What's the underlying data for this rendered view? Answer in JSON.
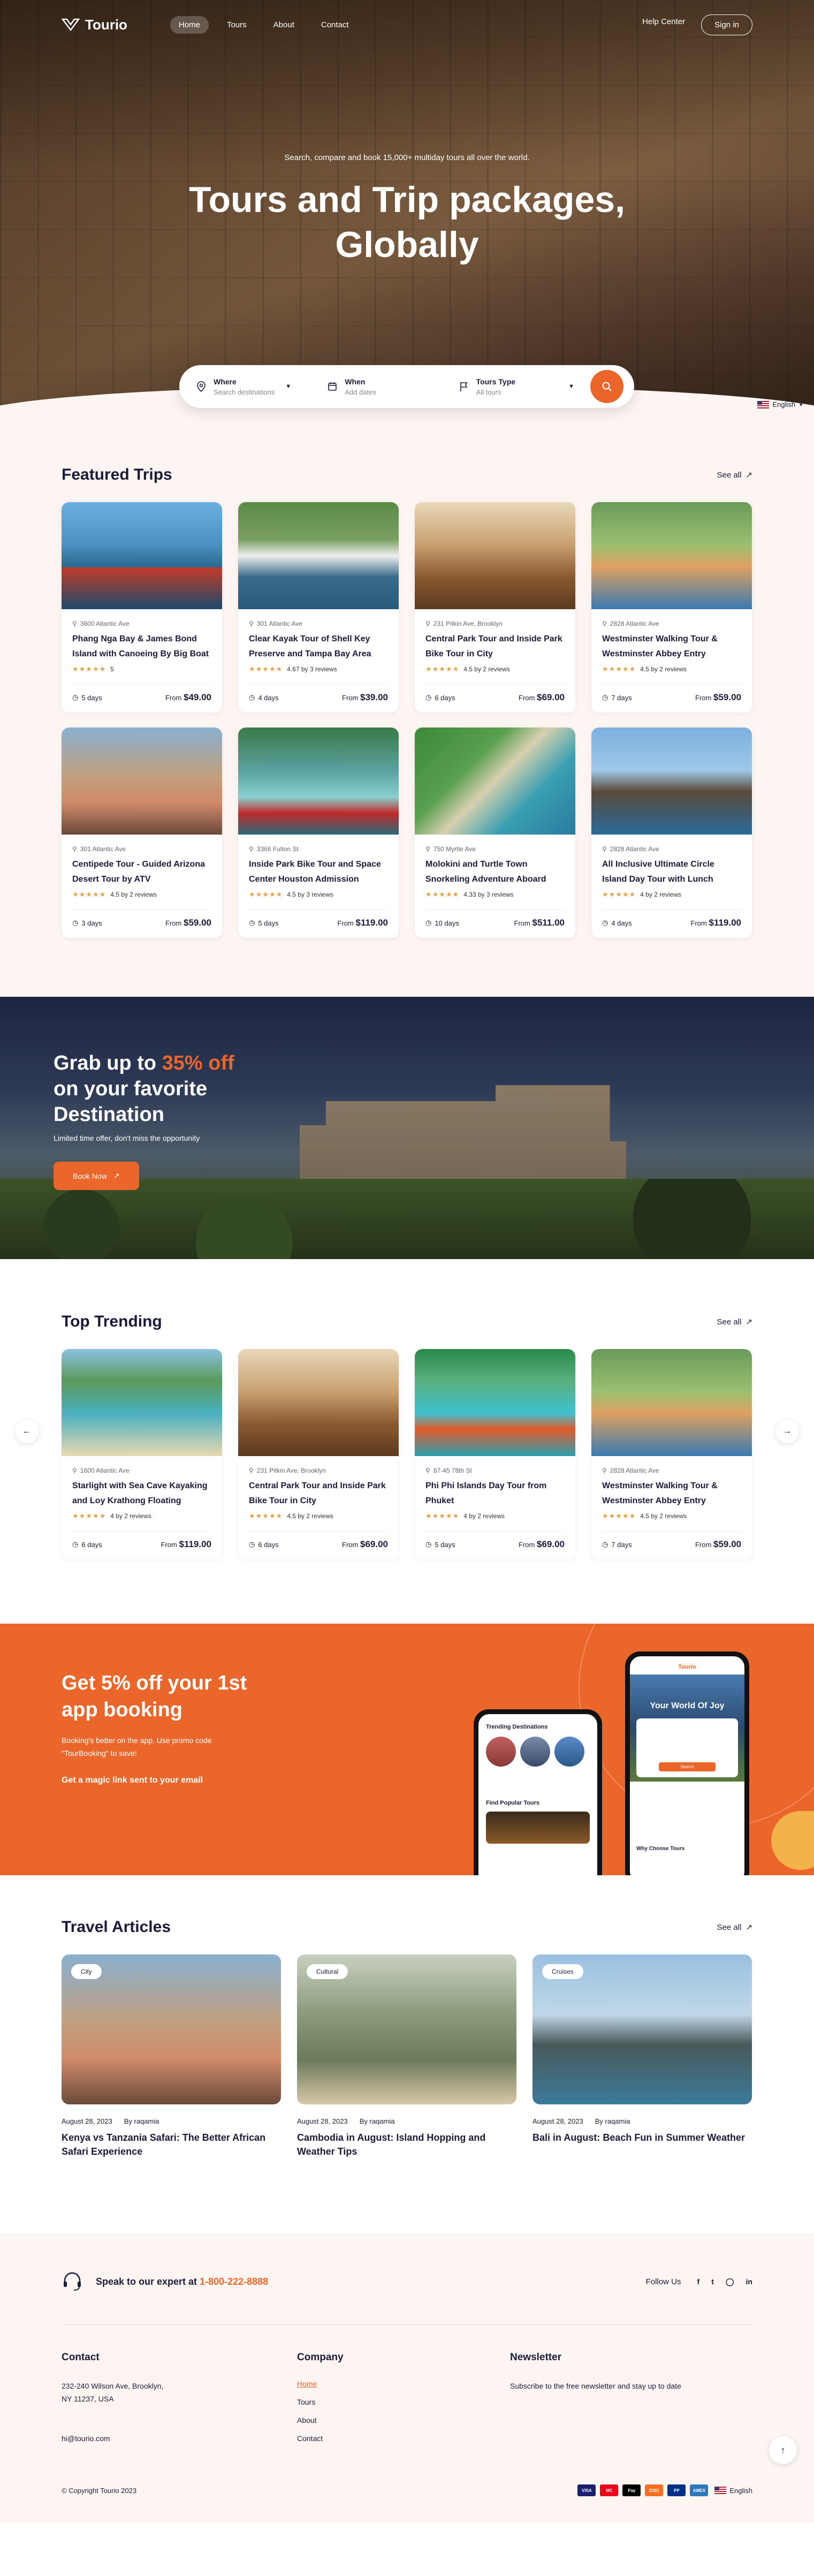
{
  "nav": {
    "brand": "Tourio",
    "links": [
      "Home",
      "Tours",
      "About",
      "Contact"
    ],
    "help": "Help Center",
    "signin": "Sign in"
  },
  "hero": {
    "subtitle": "Search, compare and book 15,000+ multiday tours all over the world.",
    "title_line1": "Tours and Trip packages,",
    "title_line2": "Globally"
  },
  "search": {
    "where_label": "Where",
    "where_placeholder": "Search destinations",
    "when_label": "When",
    "when_placeholder": "Add dates",
    "type_label": "Tours Type",
    "type_value": "All tours"
  },
  "language": "English",
  "featured": {
    "title": "Featured Trips",
    "see_all": "See all",
    "cards": [
      {
        "location": "3600 Atlantic Ave",
        "name": "Phang Nga Bay & James Bond Island with Canoeing By Big Boat",
        "rating_text": "5",
        "duration": "5 days",
        "from": "From",
        "price": "$49.00"
      },
      {
        "location": "301 Atlantic Ave",
        "name": "Clear Kayak Tour of Shell Key Preserve and Tampa Bay Area",
        "rating_text": "4.67 by 3 reviews",
        "duration": "4 days",
        "from": "From",
        "price": "$39.00"
      },
      {
        "location": "231 Pitkin Ave, Brooklyn",
        "name": "Central Park Tour and Inside Park Bike Tour in City",
        "rating_text": "4.5 by 2 reviews",
        "duration": "6 days",
        "from": "From",
        "price": "$69.00"
      },
      {
        "location": "2828 Atlantic Ave",
        "name": "Westminster Walking Tour & Westminster Abbey Entry",
        "rating_text": "4.5 by 2 reviews",
        "duration": "7 days",
        "from": "From",
        "price": "$59.00"
      },
      {
        "location": "301 Atlantic Ave",
        "name": "Centipede Tour - Guided Arizona Desert Tour by ATV",
        "rating_text": "4.5 by 2 reviews",
        "duration": "3 days",
        "from": "From",
        "price": "$59.00"
      },
      {
        "location": "3366 Fulton St",
        "name": "Inside Park Bike Tour and Space Center Houston Admission",
        "rating_text": "4.5 by 3 reviews",
        "duration": "5 days",
        "from": "From",
        "price": "$119.00"
      },
      {
        "location": "750 Myrtle Ave",
        "name": "Molokini and Turtle Town Snorkeling Adventure Aboard",
        "rating_text": "4.33 by 3 reviews",
        "duration": "10 days",
        "from": "From",
        "price": "$511.00"
      },
      {
        "location": "2828 Atlantic Ave",
        "name": "All Inclusive Ultimate Circle Island Day Tour with Lunch",
        "rating_text": "4 by 2 reviews",
        "duration": "4 days",
        "from": "From",
        "price": "$119.00"
      }
    ]
  },
  "promo": {
    "title_pre": "Grab up to ",
    "title_highlight": "35% off",
    "title_line2": "on your favorite",
    "title_line3": "Destination",
    "subtitle": "Limited time offer, don't miss the opportunity",
    "button": "Book Now"
  },
  "trending": {
    "title": "Top Trending",
    "see_all": "See all",
    "cards": [
      {
        "location": "1600 Atlantic Ave",
        "name": "Starlight with Sea Cave Kayaking and Loy Krathong Floating",
        "rating_text": "4 by 2 reviews",
        "duration": "6 days",
        "from": "From",
        "price": "$119.00"
      },
      {
        "location": "231 Pitkin Ave, Brooklyn",
        "name": "Central Park Tour and Inside Park Bike Tour in City",
        "rating_text": "4.5 by 2 reviews",
        "duration": "6 days",
        "from": "From",
        "price": "$69.00"
      },
      {
        "location": "87-45 78th St",
        "name": "Phi Phi Islands Day Tour from Phuket",
        "rating_text": "4 by 2 reviews",
        "duration": "5 days",
        "from": "From",
        "price": "$69.00"
      },
      {
        "location": "2828 Atlantic Ave",
        "name": "Westminster Walking Tour & Westminster Abbey Entry",
        "rating_text": "4.5 by 2 reviews",
        "duration": "7 days",
        "from": "From",
        "price": "$59.00"
      }
    ]
  },
  "app": {
    "title_line1": "Get 5% off your 1st",
    "title_line2": "app booking",
    "sub1": "Booking's better on the app. Use promo code",
    "sub2": "\"TourBooking\" to save!",
    "magic": "Get a magic link sent to your email",
    "phone1_heading": "Trending Destinations",
    "phone1_popular": "Find Popular Tours",
    "phone2_brand": "Tourio",
    "phone2_hero": "Your World Of Joy",
    "phone2_search": "Search",
    "phone2_why": "Why Choose Tours"
  },
  "articles": {
    "title": "Travel Articles",
    "see_all": "See all",
    "items": [
      {
        "tag": "City",
        "date": "August 28, 2023",
        "author": "By raqamia",
        "title": "Kenya vs Tanzania Safari: The Better African Safari Experience"
      },
      {
        "tag": "Cultural",
        "date": "August 28, 2023",
        "author": "By raqamia",
        "title": "Cambodia in August: Island Hopping and Weather Tips"
      },
      {
        "tag": "Cruises",
        "date": "August 28, 2023",
        "author": "By raqamia",
        "title": "Bali in August: Beach Fun in Summer Weather"
      }
    ]
  },
  "footer": {
    "speak_pre": "Speak to our expert at ",
    "phone": "1-800-222-8888",
    "follow": "Follow Us",
    "social": [
      "f",
      "t",
      "in",
      "in"
    ],
    "contact_title": "Contact",
    "address1": "232-240 Wilson Ave, Brooklyn,",
    "address2": "NY 11237, USA",
    "email": "hi@tourio.com",
    "company_title": "Company",
    "company_links": [
      "Home",
      "Tours",
      "About",
      "Contact"
    ],
    "newsletter_title": "Newsletter",
    "newsletter_text": "Subscribe to the free newsletter and stay up to date",
    "copyright": "© Copyright Tourio 2023",
    "payments": [
      "VISA",
      "MC",
      "Pay",
      "DISC",
      "PP",
      "AMEX"
    ],
    "language": "English"
  },
  "colors": {
    "accent": "#eb662b",
    "navy": "#1a1b3a",
    "cream": "#fcf5f1"
  }
}
